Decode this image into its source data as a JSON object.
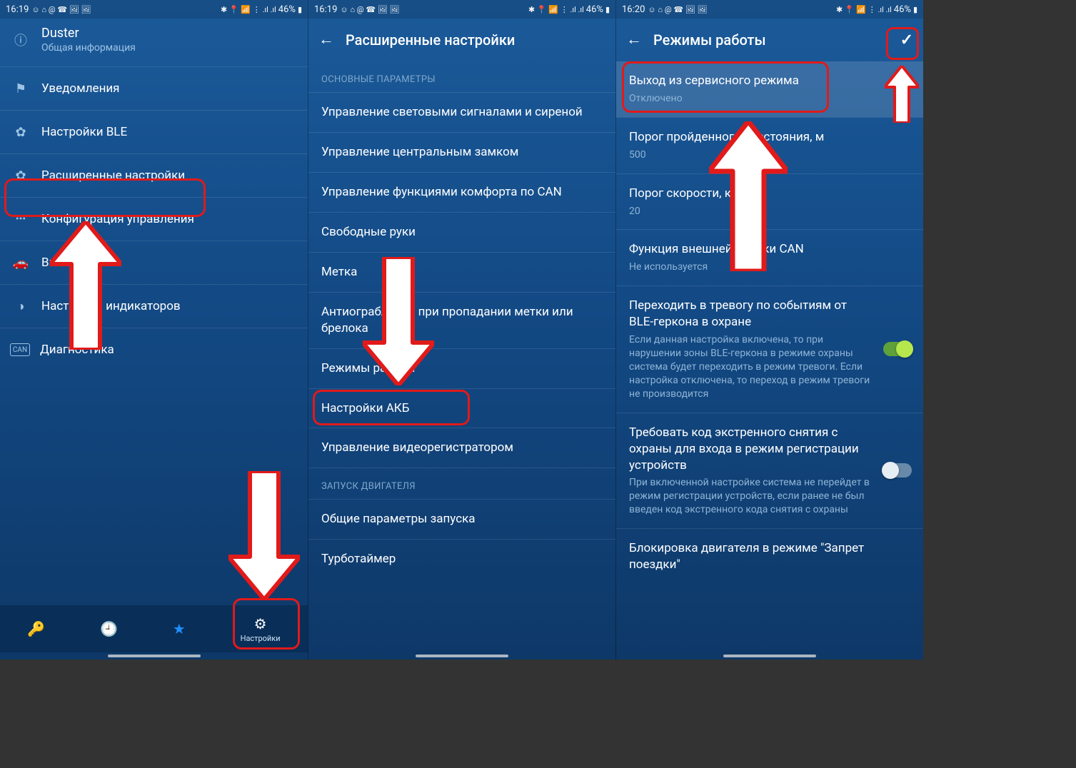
{
  "status": {
    "time_a": "16:19",
    "time_b": "16:19",
    "time_c": "16:20",
    "left_icons": "☺ ⌂ @ ☎ 🖼 🖼",
    "right_icons": "✱ 📍 📶 ⋮ .ıl .ıl",
    "battery": "46%",
    "batt_icon": "▮"
  },
  "screen1": {
    "header": {
      "title": "Duster",
      "subtitle": "Общая информация"
    },
    "items": [
      {
        "icon": "⚑",
        "label": "Уведомления"
      },
      {
        "icon": "✿",
        "label": "Настройки BLE"
      },
      {
        "icon": "✿",
        "label": "Расширенные настройки"
      },
      {
        "icon": "•••",
        "label": "Конфигурация управления"
      },
      {
        "icon": "🚗",
        "label": "Выбор авто"
      },
      {
        "icon": "◑",
        "label": "Настройка индикаторов"
      },
      {
        "icon": "CAN",
        "label": "Диагностика"
      }
    ],
    "bottom": [
      {
        "icon": "🔑",
        "label": ""
      },
      {
        "icon": "🕘",
        "label": ""
      },
      {
        "icon": "★",
        "label": ""
      },
      {
        "icon": "⚙",
        "label": "Настройки"
      }
    ]
  },
  "screen2": {
    "title": "Расширенные настройки",
    "section_a": "ОСНОВНЫЕ ПАРАМЕТРЫ",
    "items_a": [
      "Управление световыми сигналами и сиреной",
      "Управление центральным замком",
      "Управление функциями комфорта по CAN",
      "Свободные руки",
      "Метка",
      "Антиограбление при пропадании метки или брелока",
      "Режимы работы",
      "Настройки АКБ",
      "Управление видеорегистратором"
    ],
    "section_b": "ЗАПУСК ДВИГАТЕЛЯ",
    "items_b": [
      "Общие параметры запуска",
      "Турботаймер"
    ]
  },
  "screen3": {
    "title": "Режимы работы",
    "items": [
      {
        "title": "Выход из сервисного режима",
        "sub": "Отключено"
      },
      {
        "title": "Порог пройденного расстояния, м",
        "sub": "500"
      },
      {
        "title": "Порог скорости, км/час",
        "sub": "20"
      },
      {
        "title": "Функция внешней кнопки CAN",
        "sub": "Не используется"
      },
      {
        "title": "Переходить в тревогу по событиям от BLE-геркона в охране",
        "sub": "Если данная настройка включена, то при нарушении зоны BLE-геркона в режиме охраны система будет переходить в режим тревоги. Если настройка отключена, то переход в режим тревоги не производится",
        "toggle": "on"
      },
      {
        "title": "Требовать код экстренного снятия с охраны для входа в режим регистрации устройств",
        "sub": "При включенной настройке система не перейдет в режим регистрации устройств, если ранее не был введен код экстренного кода снятия с охраны",
        "toggle": "off"
      },
      {
        "title": "Блокировка двигателя в режиме \"Запрет поездки\""
      }
    ]
  }
}
